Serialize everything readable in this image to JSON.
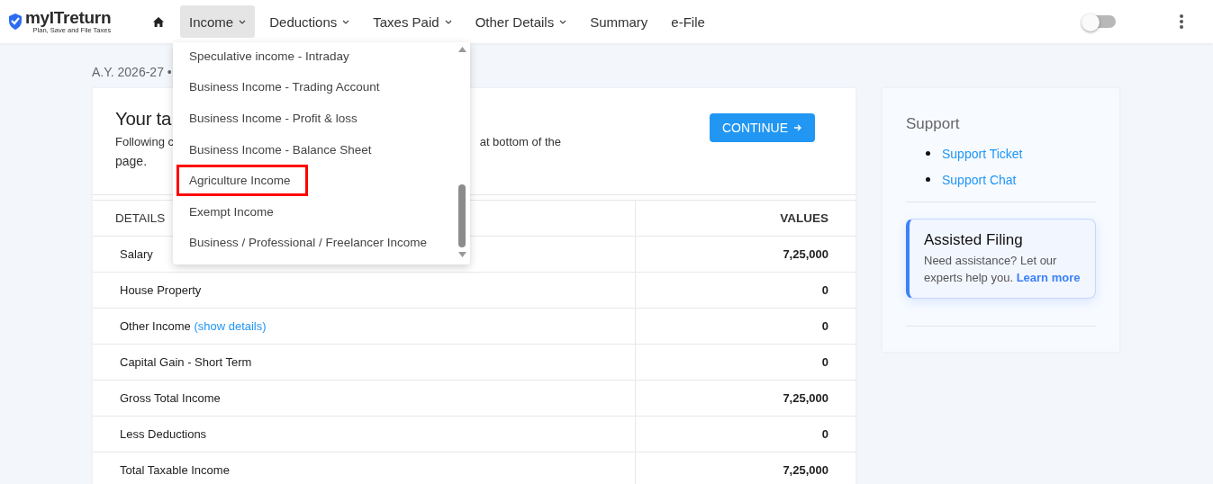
{
  "logo": {
    "name": "myITreturn",
    "tagline": "Plan, Save and File Taxes"
  },
  "nav": [
    {
      "label": "Income",
      "selected": true,
      "dropdown": true
    },
    {
      "label": "Deductions",
      "selected": false,
      "dropdown": true
    },
    {
      "label": "Taxes Paid",
      "selected": false,
      "dropdown": true
    },
    {
      "label": "Other Details",
      "selected": false,
      "dropdown": true
    },
    {
      "label": "Summary",
      "selected": false,
      "dropdown": false
    },
    {
      "label": "e-File",
      "selected": false,
      "dropdown": false
    }
  ],
  "theme_toggle": {
    "on": false
  },
  "income_menu": {
    "items": [
      {
        "label": "Speculative income - Intraday",
        "highlighted": false
      },
      {
        "label": "Business Income - Trading Account",
        "highlighted": false
      },
      {
        "label": "Business Income - Profit & loss",
        "highlighted": false
      },
      {
        "label": "Business Income - Balance Sheet",
        "highlighted": false
      },
      {
        "label": "Agriculture Income",
        "highlighted": true
      },
      {
        "label": "Exempt Income",
        "highlighted": false
      },
      {
        "label": "Business / Professional / Freelancer Income",
        "highlighted": false
      }
    ]
  },
  "breadcrumb": "A.Y. 2026-27 •",
  "tax_card": {
    "title": "Your ta",
    "description_start": "Following c",
    "description_end": "at bottom of the",
    "description_line2": "page.",
    "continue_button": "CONTINUE",
    "table": {
      "columns": [
        "DETAILS",
        "VALUES"
      ],
      "rows": [
        {
          "label": "Salary",
          "value": "7,25,000"
        },
        {
          "label": "House Property",
          "value": "0"
        },
        {
          "label": "Other Income",
          "link": "(show details)",
          "value": "0"
        },
        {
          "label": "Capital Gain - Short Term",
          "value": "0"
        },
        {
          "label": "Gross Total Income",
          "value": "7,25,000"
        },
        {
          "label": "Less Deductions",
          "value": "0"
        },
        {
          "label": "Total Taxable Income",
          "value": "7,25,000"
        }
      ]
    }
  },
  "support": {
    "title": "Support",
    "links": [
      "Support Ticket",
      "Support Chat"
    ],
    "assisted": {
      "title": "Assisted Filing",
      "text": "Need assistance? Let our experts help you.",
      "link": "Learn more"
    }
  }
}
